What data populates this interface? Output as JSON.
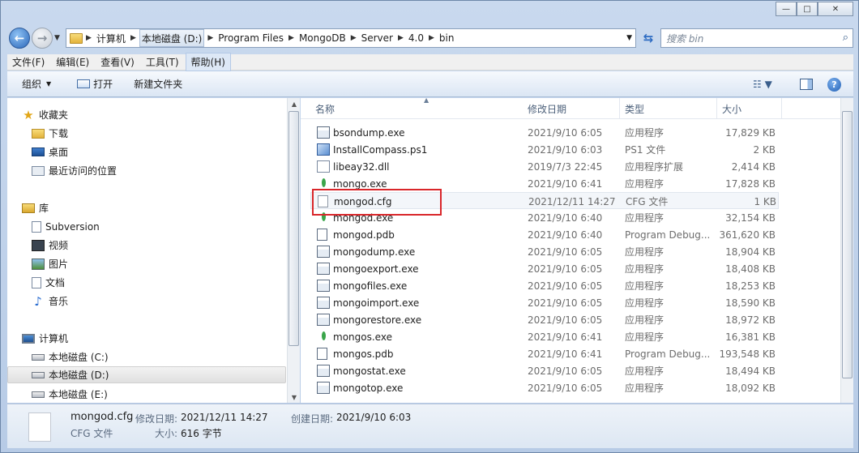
{
  "window": {
    "caption": {
      "minimize": "—",
      "maximize": "□",
      "close": "✕"
    }
  },
  "address": {
    "crumbs": [
      "计算机",
      "本地磁盘 (D:)",
      "Program Files",
      "MongoDB",
      "Server",
      "4.0",
      "bin"
    ],
    "search_placeholder": "搜索 bin"
  },
  "menu": [
    "文件(F)",
    "编辑(E)",
    "查看(V)",
    "工具(T)",
    "帮助(H)"
  ],
  "toolbar": {
    "organize": "组织",
    "open": "打开",
    "new_folder": "新建文件夹"
  },
  "nav": {
    "favorites": {
      "label": "收藏夹",
      "items": [
        "下载",
        "桌面",
        "最近访问的位置"
      ]
    },
    "libraries": {
      "label": "库",
      "items": [
        "Subversion",
        "视频",
        "图片",
        "文档",
        "音乐"
      ]
    },
    "computer": {
      "label": "计算机",
      "items": [
        "本地磁盘 (C:)",
        "本地磁盘 (D:)",
        "本地磁盘 (E:)"
      ]
    }
  },
  "columns": {
    "name": "名称",
    "date": "修改日期",
    "type": "类型",
    "size": "大小"
  },
  "files": [
    {
      "name": "bsondump.exe",
      "date": "2021/9/10 6:05",
      "type": "应用程序",
      "size": "17,829 KB",
      "icon": "exe-icon"
    },
    {
      "name": "InstallCompass.ps1",
      "date": "2021/9/10 6:03",
      "type": "PS1 文件",
      "size": "2 KB",
      "icon": "powershell-icon"
    },
    {
      "name": "libeay32.dll",
      "date": "2019/7/3 22:45",
      "type": "应用程序扩展",
      "size": "2,414 KB",
      "icon": "dll-icon"
    },
    {
      "name": "mongo.exe",
      "date": "2021/9/10 6:41",
      "type": "应用程序",
      "size": "17,828 KB",
      "icon": "mongodb-leaf-icon"
    },
    {
      "name": "mongod.cfg",
      "date": "2021/12/11 14:27",
      "type": "CFG 文件",
      "size": "1 KB",
      "icon": "cfg-file-icon"
    },
    {
      "name": "mongod.exe",
      "date": "2021/9/10 6:40",
      "type": "应用程序",
      "size": "32,154 KB",
      "icon": "mongodb-leaf-icon"
    },
    {
      "name": "mongod.pdb",
      "date": "2021/9/10 6:40",
      "type": "Program Debug...",
      "size": "361,620 KB",
      "icon": "pdb-icon"
    },
    {
      "name": "mongodump.exe",
      "date": "2021/9/10 6:05",
      "type": "应用程序",
      "size": "18,904 KB",
      "icon": "exe-icon"
    },
    {
      "name": "mongoexport.exe",
      "date": "2021/9/10 6:05",
      "type": "应用程序",
      "size": "18,408 KB",
      "icon": "exe-icon"
    },
    {
      "name": "mongofiles.exe",
      "date": "2021/9/10 6:05",
      "type": "应用程序",
      "size": "18,253 KB",
      "icon": "exe-icon"
    },
    {
      "name": "mongoimport.exe",
      "date": "2021/9/10 6:05",
      "type": "应用程序",
      "size": "18,590 KB",
      "icon": "exe-icon"
    },
    {
      "name": "mongorestore.exe",
      "date": "2021/9/10 6:05",
      "type": "应用程序",
      "size": "18,972 KB",
      "icon": "exe-icon"
    },
    {
      "name": "mongos.exe",
      "date": "2021/9/10 6:41",
      "type": "应用程序",
      "size": "16,381 KB",
      "icon": "mongodb-leaf-icon"
    },
    {
      "name": "mongos.pdb",
      "date": "2021/9/10 6:41",
      "type": "Program Debug...",
      "size": "193,548 KB",
      "icon": "pdb-icon"
    },
    {
      "name": "mongostat.exe",
      "date": "2021/9/10 6:05",
      "type": "应用程序",
      "size": "18,494 KB",
      "icon": "exe-icon"
    },
    {
      "name": "mongotop.exe",
      "date": "2021/9/10 6:05",
      "type": "应用程序",
      "size": "18,092 KB",
      "icon": "exe-icon"
    }
  ],
  "details": {
    "filename": "mongod.cfg",
    "modified_label": "修改日期:",
    "modified": "2021/12/11 14:27",
    "created_label": "创建日期:",
    "created": "2021/9/10 6:03",
    "type": "CFG 文件",
    "size_label": "大小:",
    "size": "616 字节"
  },
  "highlight_color": "#d9262a"
}
